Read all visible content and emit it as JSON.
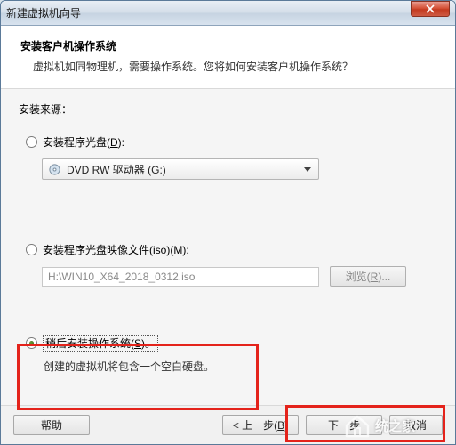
{
  "window": {
    "title": "新建虚拟机向导"
  },
  "header": {
    "title": "安装客户机操作系统",
    "subtitle": "虚拟机如同物理机，需要操作系统。您将如何安装客户机操作系统？"
  },
  "source_label": "安装来源：",
  "options": {
    "disc": {
      "label_prefix": "安装程序光盘(",
      "hotkey": "D",
      "label_suffix": "):",
      "drive_text": "DVD RW 驱动器 (G:)"
    },
    "iso": {
      "label_prefix": "安装程序光盘映像文件(iso)(",
      "hotkey": "M",
      "label_suffix": "):",
      "path": "H:\\WIN10_X64_2018_0312.iso",
      "browse_prefix": "浏览(",
      "browse_hotkey": "R",
      "browse_suffix": ")..."
    },
    "later": {
      "label_prefix": "稍后安装操作系统(",
      "hotkey": "S",
      "label_suffix": ")。",
      "desc": "创建的虚拟机将包含一个空白硬盘。"
    }
  },
  "buttons": {
    "help": "帮助",
    "back_prefix": "< 上一步(",
    "back_hotkey": "B",
    "back_suffix": ")",
    "next_full": "下一步",
    "cancel_full": "取消"
  },
  "watermark": "统之家"
}
